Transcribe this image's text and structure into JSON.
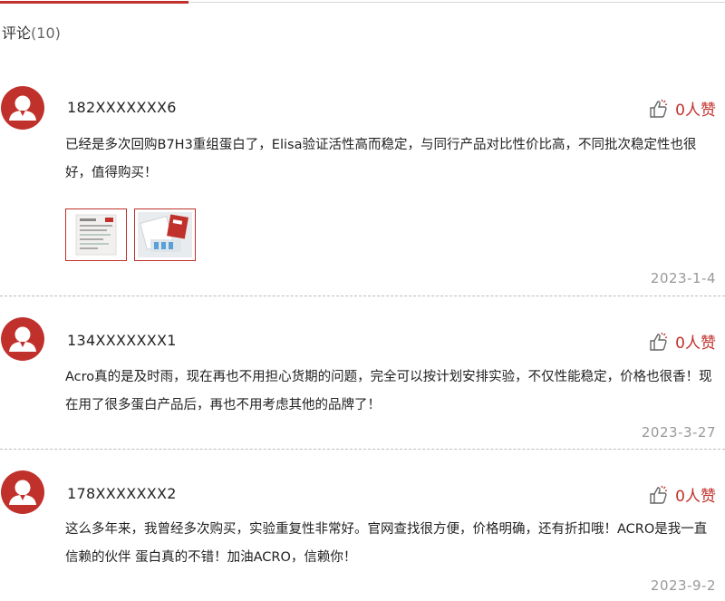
{
  "header": {
    "title": "评论",
    "count": "(10)"
  },
  "colors": {
    "accent": "#c0312b",
    "date": "#999999",
    "divider": "#bbbbbb"
  },
  "comments": [
    {
      "username": "182XXXXXXX6",
      "likes": "0人赞",
      "text": "已经是多次回购B7H3重组蛋白了，Elisa验证活性高而稳定，与同行产品对比性价比高，不同批次稳定性也很好，值得购买！",
      "date": "2023-1-4",
      "images": [
        "document-photo",
        "product-box-photo"
      ]
    },
    {
      "username": "134XXXXXXX1",
      "likes": "0人赞",
      "text": "Acro真的是及时雨，现在再也不用担心货期的问题，完全可以按计划安排实验，不仅性能稳定，价格也很香！现在用了很多蛋白产品后，再也不用考虑其他的品牌了！",
      "date": "2023-3-27",
      "images": []
    },
    {
      "username": "178XXXXXXX2",
      "likes": "0人赞",
      "text": "这么多年来，我曾经多次购买，实验重复性非常好。官网查找很方便，价格明确，还有折扣哦！ACRO是我一直信赖的伙伴 蛋白真的不错！加油ACRO，信赖你！",
      "date": "2023-9-2",
      "images": []
    }
  ]
}
